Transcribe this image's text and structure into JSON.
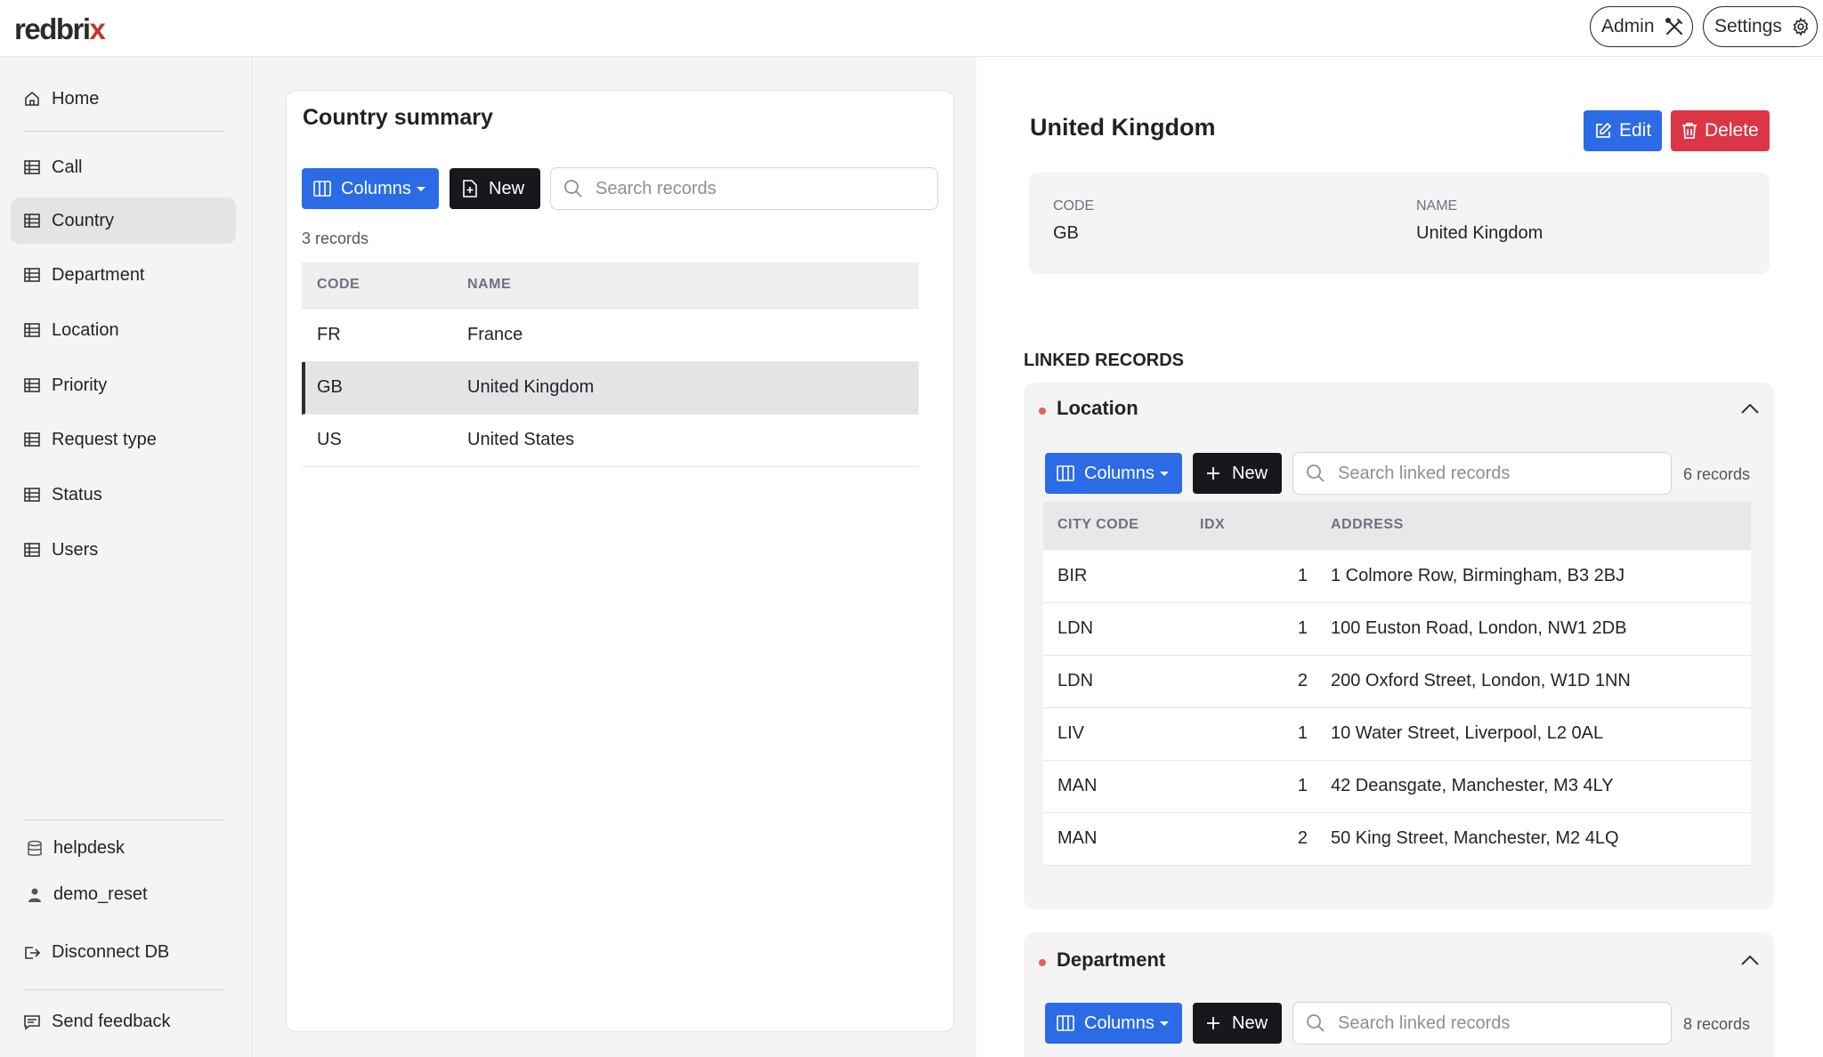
{
  "header": {
    "logo_main": "redbri",
    "logo_x": "x",
    "admin_label": "Admin",
    "settings_label": "Settings"
  },
  "sidebar": {
    "items": [
      {
        "label": "Home"
      },
      {
        "label": "Call"
      },
      {
        "label": "Country"
      },
      {
        "label": "Department"
      },
      {
        "label": "Location"
      },
      {
        "label": "Priority"
      },
      {
        "label": "Request type"
      },
      {
        "label": "Status"
      },
      {
        "label": "Users"
      }
    ],
    "active": "Country",
    "db_name": "helpdesk",
    "user_name": "demo_reset",
    "disconnect_label": "Disconnect DB",
    "feedback_label": "Send feedback"
  },
  "summary": {
    "title": "Country summary",
    "columns_label": "Columns",
    "new_label": "New",
    "search_placeholder": "Search records",
    "record_count": "3 records",
    "headers": [
      "CODE",
      "NAME"
    ],
    "rows": [
      {
        "code": "FR",
        "name": "France"
      },
      {
        "code": "GB",
        "name": "United Kingdom"
      },
      {
        "code": "US",
        "name": "United States"
      }
    ],
    "selected_code": "GB"
  },
  "detail": {
    "title": "United Kingdom",
    "edit_label": "Edit",
    "delete_label": "Delete",
    "code_label": "CODE",
    "code_value": "GB",
    "name_label": "NAME",
    "name_value": "United Kingdom"
  },
  "linked": {
    "heading": "LINKED RECORDS",
    "location": {
      "title": "Location",
      "columns_label": "Columns",
      "new_label": "New",
      "search_placeholder": "Search linked records",
      "record_count": "6 records",
      "headers": [
        "CITY CODE",
        "IDX",
        "ADDRESS"
      ],
      "rows": [
        {
          "city": "BIR",
          "idx": "1",
          "address": "1 Colmore Row, Birmingham, B3 2BJ"
        },
        {
          "city": "LDN",
          "idx": "1",
          "address": "100 Euston Road, London, NW1 2DB"
        },
        {
          "city": "LDN",
          "idx": "2",
          "address": "200 Oxford Street, London, W1D 1NN"
        },
        {
          "city": "LIV",
          "idx": "1",
          "address": "10 Water Street, Liverpool, L2 0AL"
        },
        {
          "city": "MAN",
          "idx": "1",
          "address": "42 Deansgate, Manchester, M3 4LY"
        },
        {
          "city": "MAN",
          "idx": "2",
          "address": "50 King Street, Manchester, M2 4LQ"
        }
      ]
    },
    "department": {
      "title": "Department",
      "columns_label": "Columns",
      "new_label": "New",
      "search_placeholder": "Search linked records",
      "record_count": "8 records"
    }
  },
  "colors": {
    "primary": "#2b6be6",
    "danger": "#dc3545",
    "dark": "#16181d",
    "logo_accent": "#c0392b"
  }
}
